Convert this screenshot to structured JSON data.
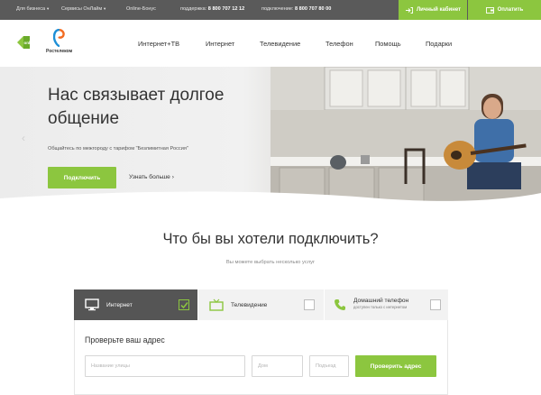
{
  "topbar": {
    "business": "Для бизнеса",
    "services": "Сервисы ОнЛайм",
    "bonus": "Online-Бонус",
    "support_label": "поддержка:",
    "support_phone": "8 800 707 12 12",
    "connect_label": "подключение:",
    "connect_phone": "8 800 707 80 00",
    "cabinet": "Личный кабинет",
    "pay": "Оплатить"
  },
  "logos": {
    "onlime_text": "onlime",
    "rt_text": "Ростелеком"
  },
  "nav": {
    "items": [
      "Интернет+ТВ",
      "Интернет",
      "Телевидение",
      "Телефон",
      "Помощь",
      "Подарки"
    ]
  },
  "hero": {
    "title": "Нас связывает долгое общение",
    "subtitle": "Общайтесь по межгороду с тарифом \"Безлимитная Россия\"",
    "connect_button": "Подключить",
    "more_link": "Узнать больше"
  },
  "section": {
    "title": "Что бы вы хотели подключить?",
    "subtitle": "Вы можете выбрать несколько услуг"
  },
  "tabs": [
    {
      "label": "Интернет",
      "checked": true
    },
    {
      "label": "Телевидение",
      "checked": false
    },
    {
      "label": "Домашний телефон",
      "note": "доступен только с интернетом",
      "checked": false
    }
  ],
  "address": {
    "title": "Проверьте ваш адрес",
    "street_placeholder": "Название улицы",
    "house_placeholder": "Дом",
    "entrance_placeholder": "Подъезд",
    "check_button": "Проверить адрес"
  },
  "colors": {
    "accent": "#8cc63f",
    "topbar": "#5a5a5a",
    "tab_active": "#555555"
  }
}
